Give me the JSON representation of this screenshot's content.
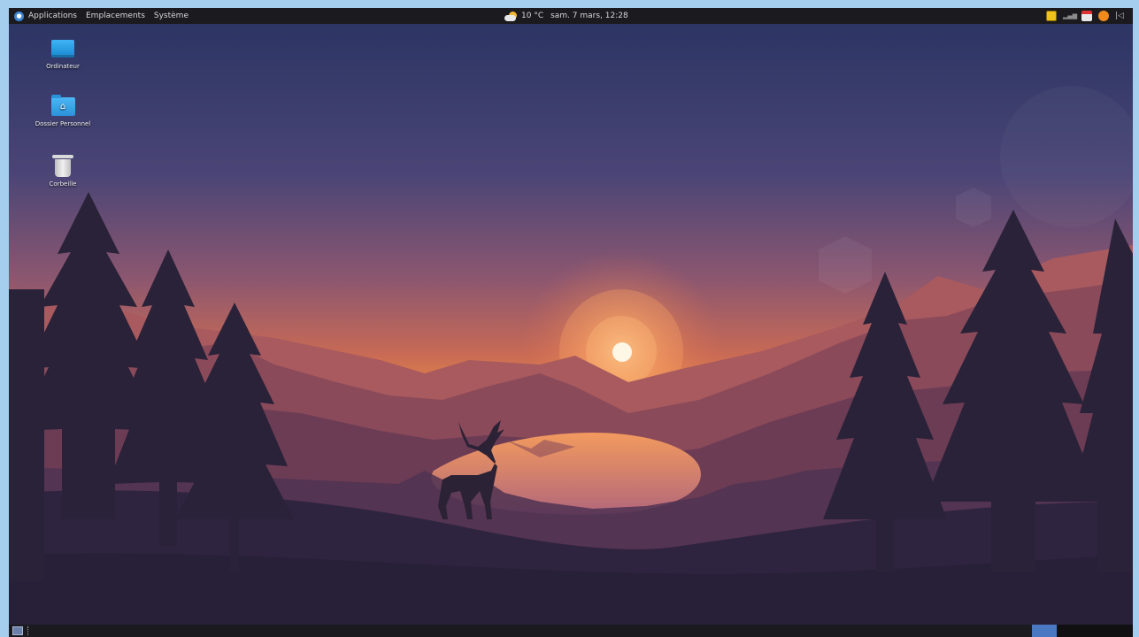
{
  "top_panel": {
    "menu": [
      "Applications",
      "Emplacements",
      "Système"
    ],
    "weather": {
      "icon": "weather-partly-cloudy-icon",
      "temperature": "10 °C"
    },
    "datetime": "sam.  7 mars, 12:28",
    "tray_icons": [
      "notes-icon",
      "network-icon",
      "mail-icon",
      "update-icon",
      "volume-icon"
    ]
  },
  "desktop": {
    "icons": [
      {
        "label": "Ordinateur",
        "icon": "computer-icon"
      },
      {
        "label": "Dossier Personnel",
        "icon": "home-folder-icon"
      },
      {
        "label": "Corbeille",
        "icon": "trash-icon"
      }
    ]
  },
  "bottom_panel": {
    "show_desktop_icon": "show-desktop-icon",
    "workspaces": 2,
    "active_workspace": 1
  },
  "colors": {
    "page_background": "#a4cdee",
    "panel": "#1b1a1f",
    "workspace_active": "#4a78c2",
    "sun": "#fff7e6"
  }
}
